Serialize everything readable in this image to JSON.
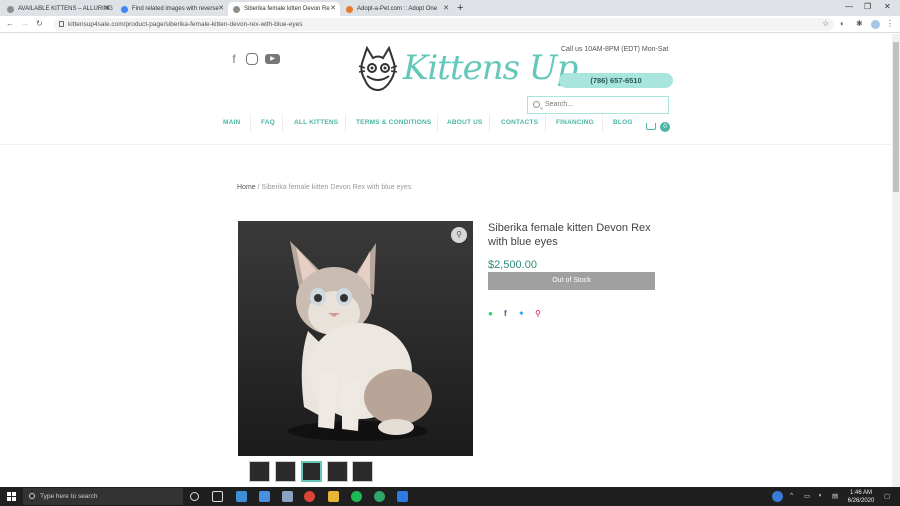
{
  "browser": {
    "tabs": [
      {
        "title": "AVAILABLE KITTENS – ALLURING",
        "active": false
      },
      {
        "title": "Find related images with reverse",
        "active": false
      },
      {
        "title": "Siberika female kitten Devon Re",
        "active": true
      },
      {
        "title": "Adopt-a-Pet.com :: Adopt One",
        "active": false
      }
    ],
    "new_tab_label": "+",
    "url": "kittensup4sale.com/product-page/siberika-female-kitten-devon-rex-with-blue-eyes"
  },
  "header": {
    "logo_text": "Kittens Up",
    "hours": "Call us 10AM-8PM (EDT)  Mon-Sat",
    "phone": "(786) 657-6510",
    "search_placeholder": "Search...",
    "cart_count": "0",
    "menu": [
      "MAIN",
      "FAQ",
      "ALL KITTENS",
      "TERMS & CONDITIONS",
      "ABOUT US",
      "CONTACTS",
      "FINANCING",
      "BLOG"
    ],
    "social": [
      "facebook-icon",
      "instagram-icon",
      "youtube-icon"
    ]
  },
  "breadcrumb": {
    "home": "Home",
    "sep": " / ",
    "current": "Siberika female kitten Devon Rex with blue eyes"
  },
  "product": {
    "title": "Siberika female kitten Devon Rex with blue eyes",
    "price": "$2,500.00",
    "stock_button": "Out of Stock",
    "share": [
      "whatsapp-icon",
      "facebook-icon",
      "twitter-icon",
      "pinterest-icon"
    ]
  },
  "taskbar": {
    "search_placeholder": "Type here to search",
    "time": "1:46 AM",
    "date": "6/26/2020"
  },
  "colors": {
    "accent": "#63c8b8",
    "price": "#2f8a7d",
    "phone_bg": "#a8e6dd"
  }
}
